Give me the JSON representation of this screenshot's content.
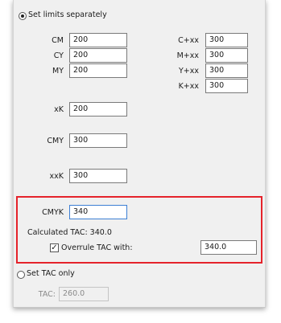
{
  "limits": {
    "separate_label": "Set limits separately",
    "separate_selected": true,
    "rows": [
      {
        "left_label": "CM",
        "left_value": "200",
        "right_label": "C+xx",
        "right_value": "300"
      },
      {
        "left_label": "CY",
        "left_value": "200",
        "right_label": "M+xx",
        "right_value": "300"
      },
      {
        "left_label": "MY",
        "left_value": "200",
        "right_label": "Y+xx",
        "right_value": "300"
      }
    ],
    "kxx_label": "K+xx",
    "kxx_value": "300",
    "xk_label": "xK",
    "xk_value": "200",
    "cmy_label": "CMY",
    "cmy_value": "300",
    "xxk_label": "xxK",
    "xxk_value": "300",
    "cmyk_label": "CMYK",
    "cmyk_value": "340",
    "calculated_tac_text": "Calculated TAC: 340.0",
    "overrule_label": "Overrule TAC with:",
    "overrule_checked": true,
    "overrule_value": "340.0"
  },
  "tac_only": {
    "label": "Set TAC only",
    "selected": false,
    "tac_label": "TAC:",
    "tac_value": "260.0"
  },
  "colors": {
    "highlight": "#e5232b",
    "focus": "#3d7fd4"
  }
}
